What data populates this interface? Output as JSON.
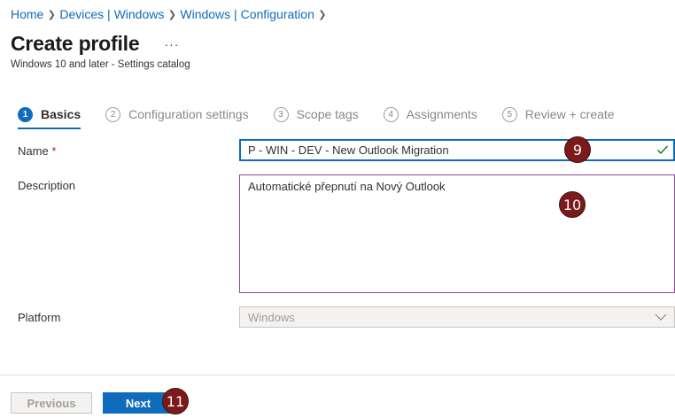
{
  "breadcrumb": {
    "items": [
      "Home",
      "Devices | Windows",
      "Windows | Configuration"
    ]
  },
  "header": {
    "title": "Create profile",
    "more_label": "···",
    "subtitle": "Windows 10 and later - Settings catalog"
  },
  "steps": [
    {
      "num": "1",
      "label": "Basics",
      "active": true
    },
    {
      "num": "2",
      "label": "Configuration settings",
      "active": false
    },
    {
      "num": "3",
      "label": "Scope tags",
      "active": false
    },
    {
      "num": "4",
      "label": "Assignments",
      "active": false
    },
    {
      "num": "5",
      "label": "Review + create",
      "active": false
    }
  ],
  "form": {
    "name_label": "Name",
    "required_mark": "*",
    "name_value": "P - WIN - DEV - New Outlook Migration",
    "description_label": "Description",
    "description_value": "Automatické přepnutí na Nový Outlook",
    "platform_label": "Platform",
    "platform_value": "Windows"
  },
  "footer": {
    "previous_label": "Previous",
    "next_label": "Next"
  },
  "markers": {
    "m9": "9",
    "m10": "10",
    "m11": "11"
  },
  "colors": {
    "accent": "#0f6cbd",
    "valid_check": "#107c10",
    "marker": "#7a1a1a"
  }
}
